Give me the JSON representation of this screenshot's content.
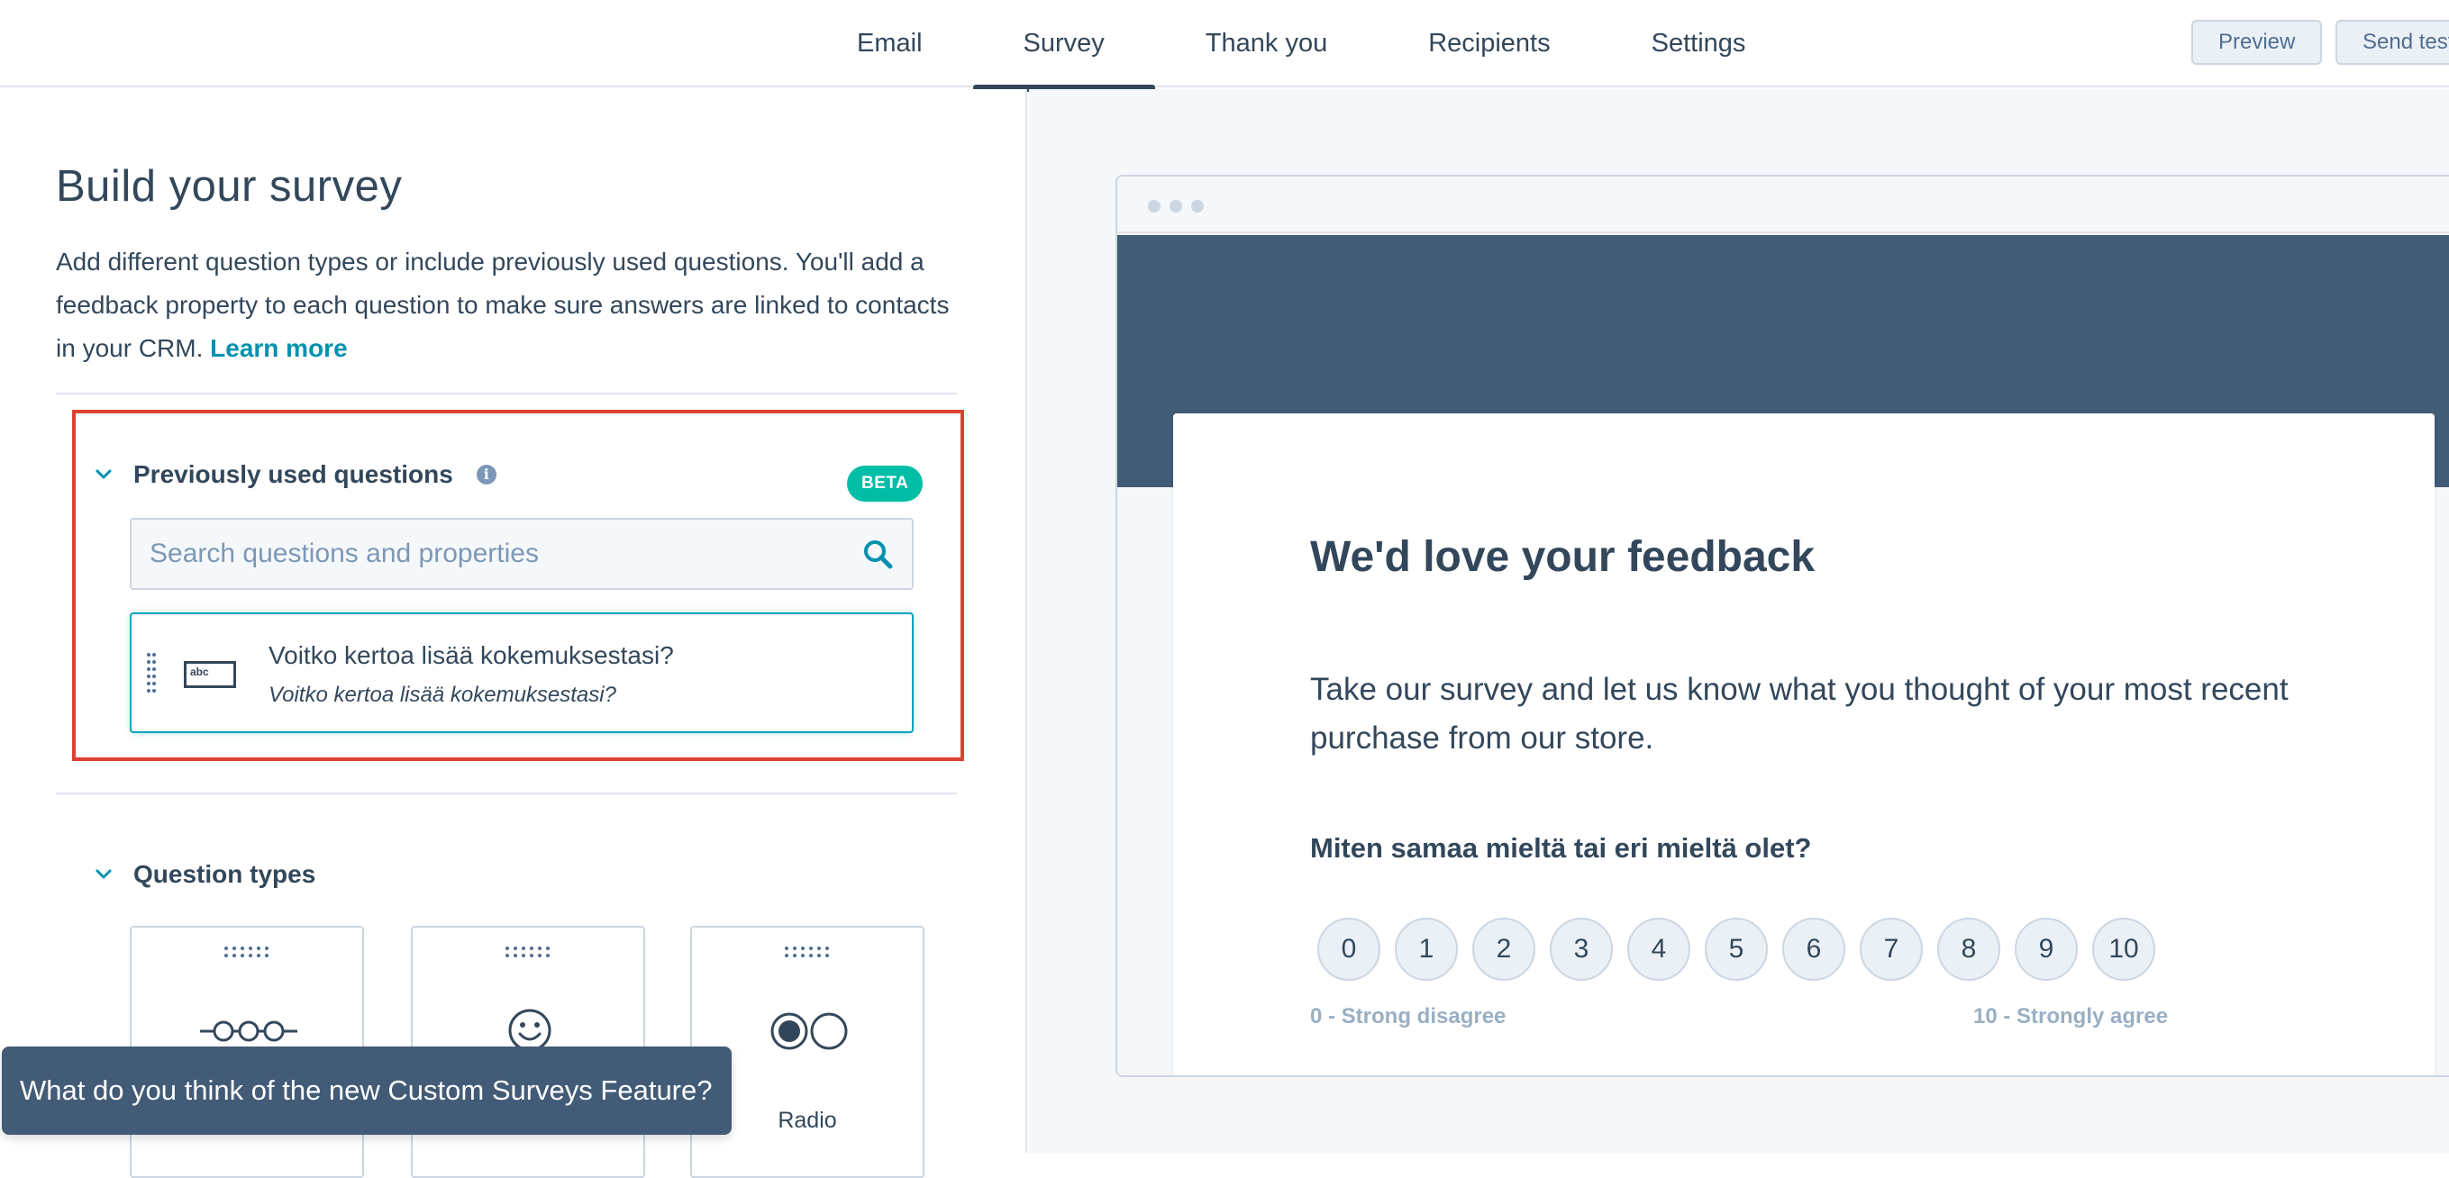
{
  "colors": {
    "text": "#33475b",
    "link": "#0091ae",
    "highlight": "#e0402f",
    "beta_badge": "#00bda5",
    "hero": "#425b76",
    "toast": "#425b76"
  },
  "nav": {
    "tabs": [
      {
        "label": "Email",
        "active": false
      },
      {
        "label": "Survey",
        "active": true
      },
      {
        "label": "Thank you",
        "active": false
      },
      {
        "label": "Recipients",
        "active": false
      },
      {
        "label": "Settings",
        "active": false
      }
    ],
    "preview_label": "Preview",
    "send_test_label": "Send test"
  },
  "builder": {
    "title": "Build your survey",
    "intro": "Add different question types or include previously used questions. You'll add a feedback property to each question to make sure answers are linked to contacts in your CRM.",
    "learn_more": "Learn more",
    "previous": {
      "heading": "Previously used questions",
      "info_icon": "info-icon",
      "badge": "BETA",
      "search_placeholder": "Search questions and properties",
      "search_icon": "search-icon",
      "question": {
        "icon": "text-field-icon",
        "icon_text": "abc",
        "title": "Voitko kertoa lisää kokemuksestasi?",
        "property": "Voitko kertoa lisää kokemuksestasi?"
      }
    },
    "question_types": {
      "heading": "Question types",
      "items": [
        {
          "icon": "scale-icon",
          "label": ""
        },
        {
          "icon": "smiley-icon",
          "label": ""
        },
        {
          "icon": "radio-icon",
          "label": "Radio"
        }
      ]
    }
  },
  "toast": {
    "text": "What do you think of the new Custom Surveys Feature?"
  },
  "preview": {
    "title": "We'd love your feedback",
    "description": "Take our survey and let us know what you thought of your most recent purchase from our store.",
    "question": "Miten samaa mieltä tai eri mieltä olet?",
    "scale": [
      "0",
      "1",
      "2",
      "3",
      "4",
      "5",
      "6",
      "7",
      "8",
      "9",
      "10"
    ],
    "low_label": "0 - Strong disagree",
    "high_label": "10 - Strongly agree"
  }
}
